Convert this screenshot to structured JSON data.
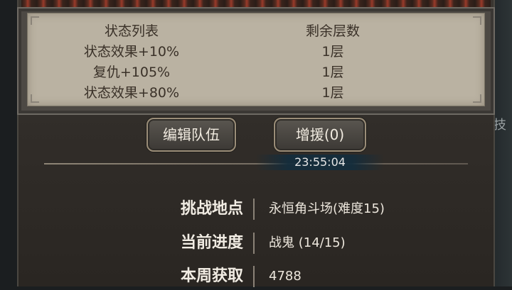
{
  "status_table": {
    "header": {
      "name": "状态列表",
      "layers": "剩余层数"
    },
    "rows": [
      {
        "name": "状态效果+10%",
        "layers": "1层"
      },
      {
        "name": "复仇+105%",
        "layers": "1层"
      },
      {
        "name": "状态效果+80%",
        "layers": "1层"
      }
    ]
  },
  "buttons": {
    "edit_team": "编辑队伍",
    "reinforce": "增援(0)"
  },
  "timer": "23:55:04",
  "info": [
    {
      "label": "挑战地点",
      "value": "永恒角斗场(难度15)"
    },
    {
      "label": "当前进度",
      "value": "战鬼 (14/15)"
    },
    {
      "label": "本周获取",
      "value": "4788"
    }
  ],
  "side_text": "技"
}
